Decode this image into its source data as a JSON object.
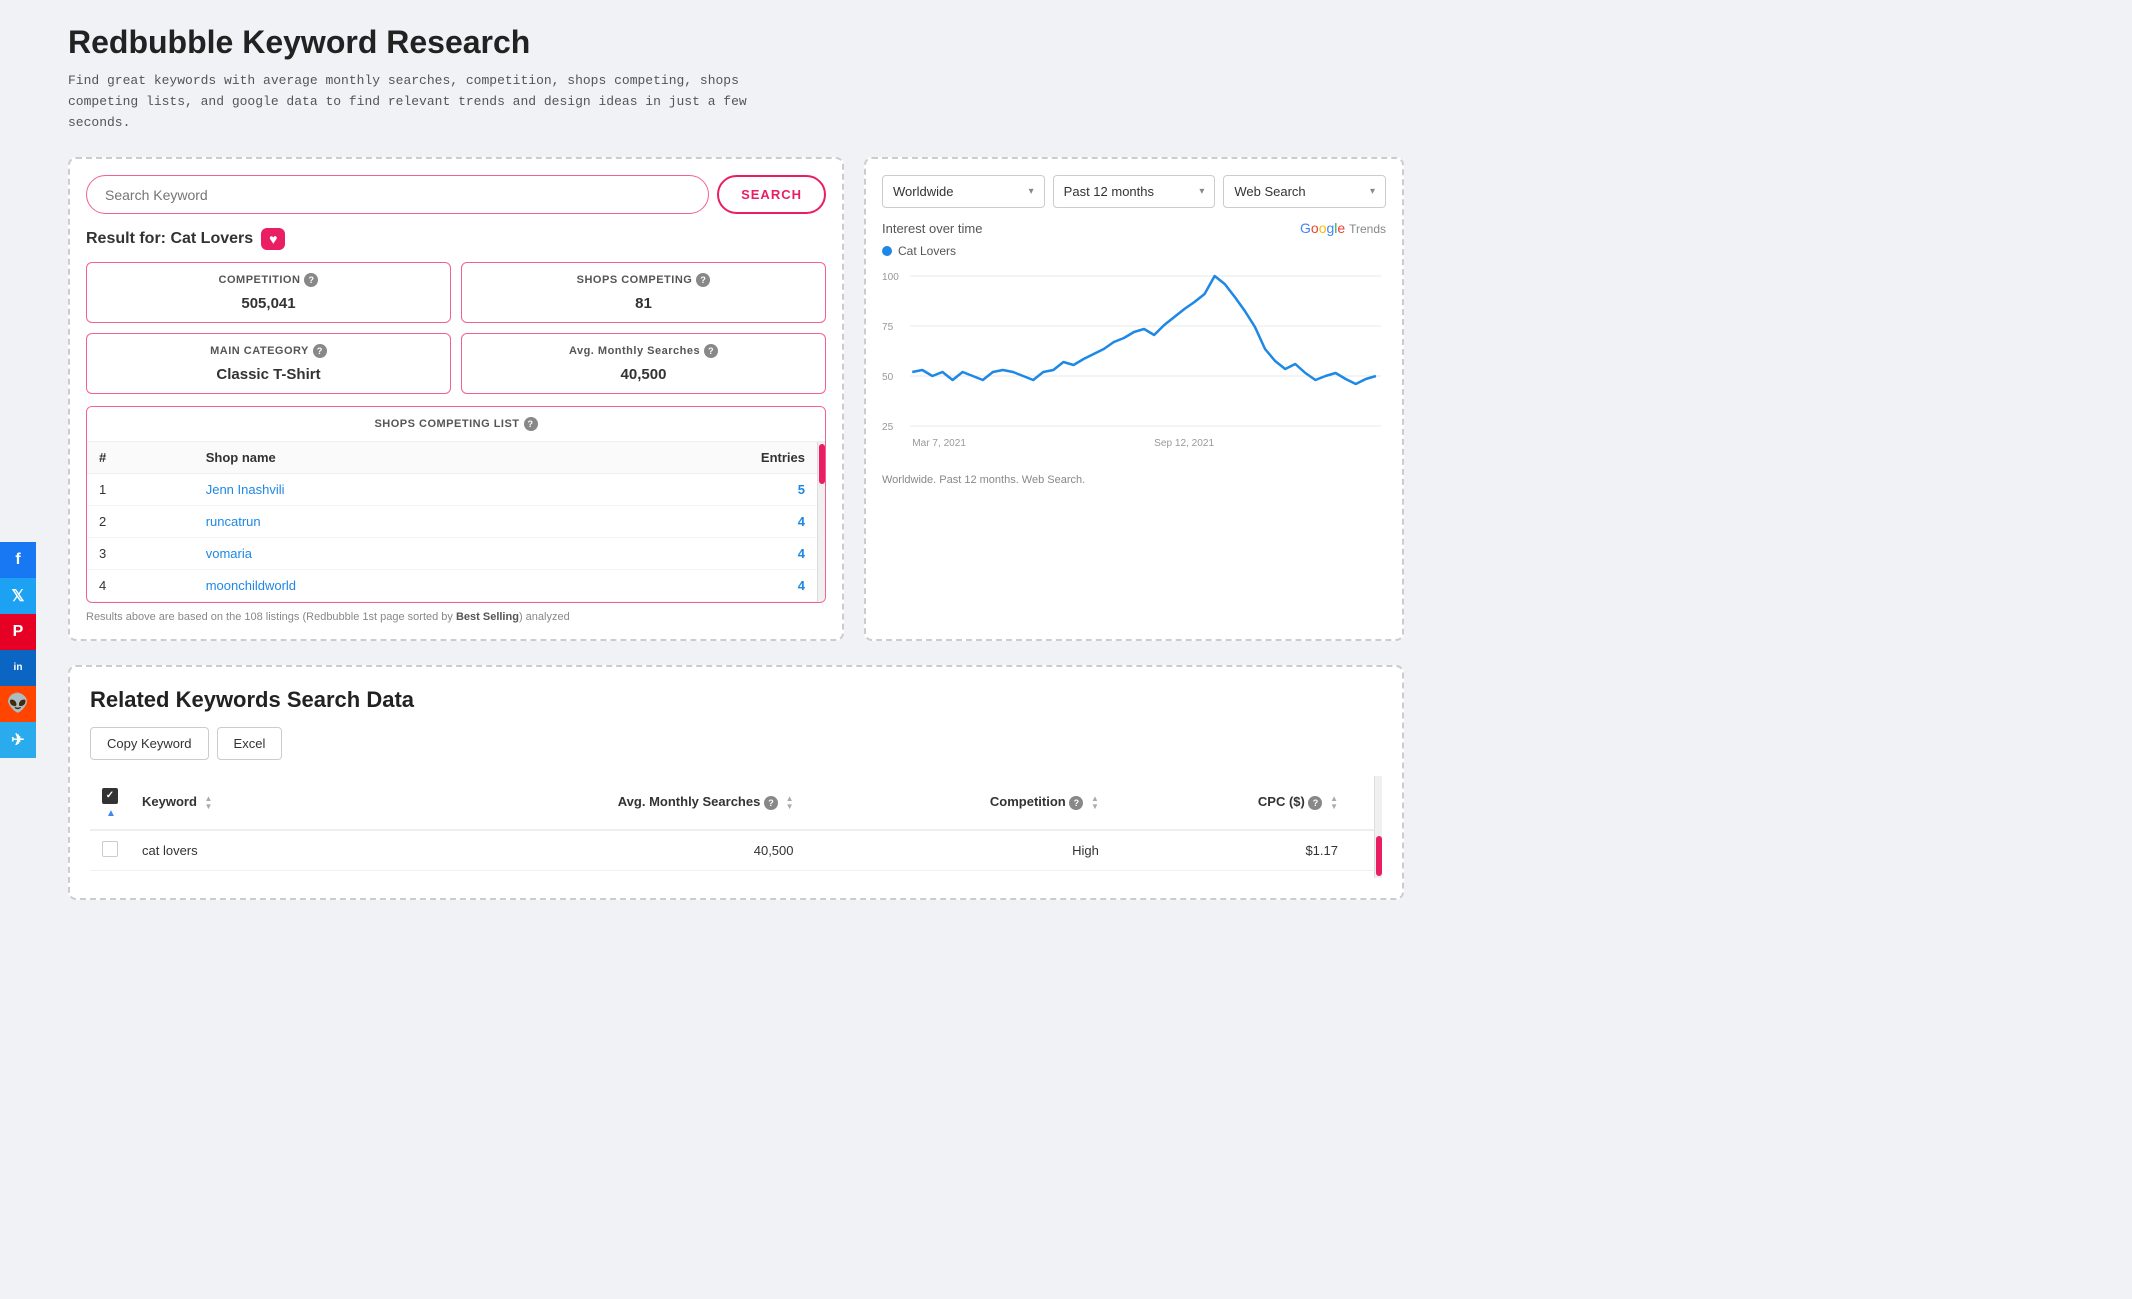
{
  "page": {
    "title": "Redbubble Keyword Research",
    "description": "Find great keywords with average monthly searches, competition, shops competing,\nshops competing lists, and google data to find relevant trends and design ideas in\njust a few seconds."
  },
  "social": {
    "items": [
      {
        "name": "facebook",
        "icon": "f",
        "class": "social-facebook"
      },
      {
        "name": "twitter",
        "icon": "t",
        "class": "social-twitter"
      },
      {
        "name": "pinterest",
        "icon": "P",
        "class": "social-pinterest"
      },
      {
        "name": "linkedin",
        "icon": "in",
        "class": "social-linkedin"
      },
      {
        "name": "reddit",
        "icon": "r",
        "class": "social-reddit"
      },
      {
        "name": "telegram",
        "icon": "✈",
        "class": "social-telegram"
      }
    ]
  },
  "search": {
    "placeholder": "Search Keyword",
    "button_label": "SEARCH"
  },
  "result": {
    "label": "Result for: Cat Lovers",
    "heart": "♥",
    "stats": [
      {
        "id": "competition",
        "label": "COMPETITION",
        "value": "505,041"
      },
      {
        "id": "shops_competing",
        "label": "SHOPS COMPETING",
        "value": "81"
      },
      {
        "id": "main_category",
        "label": "MAIN CATEGORY",
        "value": "Classic T-Shirt"
      },
      {
        "id": "avg_monthly",
        "label": "Avg. Monthly Searches",
        "value": "40,500"
      }
    ],
    "shops_list_label": "SHOPS COMPETING LIST",
    "table": {
      "columns": [
        "#",
        "Shop name",
        "Entries"
      ],
      "rows": [
        {
          "rank": 1,
          "name": "Jenn Inashvili",
          "entries": 5
        },
        {
          "rank": 2,
          "name": "runcatrun",
          "entries": 4
        },
        {
          "rank": 3,
          "name": "vomaria",
          "entries": 4
        },
        {
          "rank": 4,
          "name": "moonchildworld",
          "entries": 4
        }
      ]
    },
    "footer": "Results above are based on the 108 listings (Redbubble 1st page sorted by Best Selling) analyzed"
  },
  "trends": {
    "dropdowns": [
      {
        "label": "Worldwide",
        "value": "worldwide"
      },
      {
        "label": "Past 12 months",
        "value": "past12months"
      },
      {
        "label": "Web Search",
        "value": "websearch"
      }
    ],
    "interest_label": "Interest over time",
    "google_trends_label": "Google Trends",
    "legend": "Cat Lovers",
    "y_labels": [
      "100",
      "75",
      "50",
      "25"
    ],
    "x_labels": [
      "Mar 7, 2021",
      "Sep 12, 2021"
    ],
    "footer": "Worldwide. Past 12 months. Web Search.",
    "chart_data": [
      42,
      45,
      40,
      43,
      38,
      42,
      40,
      38,
      42,
      45,
      43,
      40,
      38,
      42,
      45,
      50,
      48,
      52,
      55,
      58,
      62,
      65,
      70,
      72,
      68,
      75,
      80,
      85,
      90,
      95,
      100,
      95,
      88,
      80,
      72,
      55,
      50,
      45,
      48,
      42,
      38,
      40,
      42,
      38,
      35,
      38,
      40
    ]
  },
  "related": {
    "title": "Related Keywords Search Data",
    "buttons": [
      {
        "label": "Copy Keyword"
      },
      {
        "label": "Excel"
      }
    ],
    "table": {
      "columns": [
        {
          "label": "Keyword",
          "sortable": true
        },
        {
          "label": "Avg. Monthly Searches",
          "sortable": true,
          "help": true
        },
        {
          "label": "Competition",
          "sortable": true,
          "help": true
        },
        {
          "label": "CPC ($)",
          "sortable": true,
          "help": true
        }
      ],
      "rows": [
        {
          "keyword": "cat lovers",
          "avg_monthly": "40,500",
          "competition": "High",
          "cpc": "$1.17"
        }
      ]
    }
  }
}
